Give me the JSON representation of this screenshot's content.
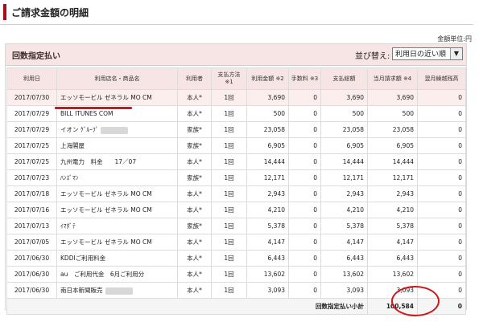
{
  "page": {
    "title": "ご請求金額の明細",
    "unit": "金額単位:円"
  },
  "panel": {
    "label": "回数指定払い",
    "sort_label": "並び替え:",
    "sort_selected": "利用日の近い順"
  },
  "columns": [
    "利用日",
    "利用店名・商品名",
    "利用者",
    "支払方法 ※1",
    "利用金額 ※2",
    "手数料 ※3",
    "支払総額",
    "当月請求額 ※4",
    "翌月繰越残高"
  ],
  "rows": [
    {
      "date": "2017/07/30",
      "store": "エッソモービル ゼネラル MO CM",
      "user": "本人*",
      "method": "1回",
      "amount": "3,690",
      "fee": "0",
      "total": "3,690",
      "current": "3,690",
      "carry": "0",
      "blurred": false
    },
    {
      "date": "2017/07/29",
      "store": "BILL ITUNES COM",
      "user": "本人*",
      "method": "1回",
      "amount": "500",
      "fee": "0",
      "total": "500",
      "current": "500",
      "carry": "0",
      "blurred": false
    },
    {
      "date": "2017/07/29",
      "store": "イオン ｸﾞﾙｰﾌﾟ",
      "user": "家族*",
      "method": "1回",
      "amount": "23,058",
      "fee": "0",
      "total": "23,058",
      "current": "23,058",
      "carry": "0",
      "blurred": true
    },
    {
      "date": "2017/07/25",
      "store": "上海閣屋",
      "user": "家族*",
      "method": "1回",
      "amount": "6,905",
      "fee": "0",
      "total": "6,905",
      "current": "6,905",
      "carry": "0",
      "blurred": false
    },
    {
      "date": "2017/07/25",
      "store": "九州電力　料金　　17／07",
      "user": "本人*",
      "method": "1回",
      "amount": "14,444",
      "fee": "0",
      "total": "14,444",
      "current": "14,444",
      "carry": "0",
      "blurred": false
    },
    {
      "date": "2017/07/23",
      "store": "ﾊﾝｽﾞﾏﾝ",
      "user": "家族*",
      "method": "1回",
      "amount": "12,171",
      "fee": "0",
      "total": "12,171",
      "current": "12,171",
      "carry": "0",
      "blurred": false
    },
    {
      "date": "2017/07/18",
      "store": "エッソモービル ゼネラル MO CM",
      "user": "本人*",
      "method": "1回",
      "amount": "2,943",
      "fee": "0",
      "total": "2,943",
      "current": "2,943",
      "carry": "0",
      "blurred": false
    },
    {
      "date": "2017/07/16",
      "store": "エッソモービル ゼネラル MO CM",
      "user": "本人*",
      "method": "1回",
      "amount": "4,210",
      "fee": "0",
      "total": "4,210",
      "current": "4,210",
      "carry": "0",
      "blurred": false
    },
    {
      "date": "2017/07/13",
      "store": "ｲﾏﾀﾞﾃ",
      "user": "家族*",
      "method": "1回",
      "amount": "5,378",
      "fee": "0",
      "total": "5,378",
      "current": "5,378",
      "carry": "0",
      "blurred": false
    },
    {
      "date": "2017/07/05",
      "store": "エッソモービル ゼネラル MO CM",
      "user": "本人*",
      "method": "1回",
      "amount": "4,147",
      "fee": "0",
      "total": "4,147",
      "current": "4,147",
      "carry": "0",
      "blurred": false
    },
    {
      "date": "2017/06/30",
      "store": "KDDIご利用料金",
      "user": "本人*",
      "method": "1回",
      "amount": "6,443",
      "fee": "0",
      "total": "6,443",
      "current": "6,443",
      "carry": "0",
      "blurred": false
    },
    {
      "date": "2017/06/30",
      "store": "au　ご利用代金　6月ご利用分",
      "user": "本人*",
      "method": "1回",
      "amount": "13,602",
      "fee": "0",
      "total": "13,602",
      "current": "13,602",
      "carry": "0",
      "blurred": false
    },
    {
      "date": "2017/06/30",
      "store": "南日本新聞販売",
      "user": "本人*",
      "method": "1回",
      "amount": "3,093",
      "fee": "0",
      "total": "3,093",
      "current": "3,093",
      "carry": "0",
      "blurred": true
    }
  ],
  "subtotal": {
    "label": "回数指定払い小計",
    "current": "100,584",
    "carry": "0"
  },
  "colors": {
    "accent": "#a30f14",
    "header_bg": "#f7e4e4",
    "annotation_red": "#d0161a"
  }
}
